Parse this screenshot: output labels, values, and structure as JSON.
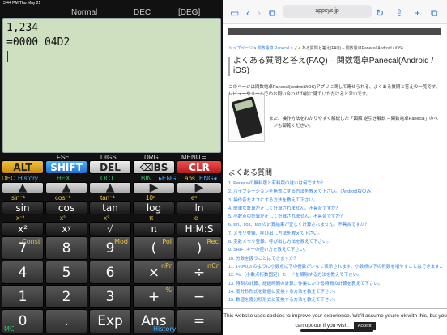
{
  "status": {
    "time": "3:44 PM",
    "date": "Thu May 21"
  },
  "modebar": {
    "mode": "Normal",
    "base": "DEC",
    "angle": "[DEG]"
  },
  "display": {
    "line1": "1,234",
    "line2": "=0000 04D2"
  },
  "colors": {
    "alt": "#f0c23c",
    "shift": "#4cb0ff",
    "clr": "#f26060",
    "hex": "#3cc06c",
    "link": "#2a7ae4"
  },
  "keys": {
    "row1_labels": [
      "FSE",
      "DIGS",
      "DRG",
      "MENU ="
    ],
    "alt": "ALT",
    "shift": "SHIFT",
    "del": "DEL",
    "bs": "⌫BS",
    "clr": "CLR",
    "row2_labels": [
      "DEC",
      "History",
      "HEX",
      "OCT",
      "BIN",
      "▸ENG",
      "abs",
      "ENG◂"
    ],
    "nav": [
      "▲",
      "▲",
      "▲",
      "▶",
      "▶"
    ],
    "sup3": [
      "sin⁻¹",
      "cos⁻¹",
      "tan⁻¹",
      "10ˣ",
      "eˣ"
    ],
    "fn3": [
      "sin",
      "cos",
      "tan",
      "log",
      "ln"
    ],
    "sup4": [
      "x⁻¹",
      "x²",
      "x³",
      "π",
      "e"
    ],
    "fn4": [
      "x²",
      "xʸ",
      "√",
      "π",
      "H:M:S"
    ],
    "row5": [
      "7",
      "8",
      "9",
      "(",
      ")"
    ],
    "row5_sub": [
      "Const",
      "Mod",
      "Pol",
      "Rec"
    ],
    "row6": [
      "4",
      "5",
      "6",
      "×",
      "÷"
    ],
    "row6_sub": [
      "nPr",
      "nCr"
    ],
    "row7": [
      "1",
      "2",
      "3",
      "+",
      "−"
    ],
    "row7_sub": [
      "%"
    ],
    "row8": [
      "0",
      ".",
      "Exp",
      "Ans",
      "="
    ],
    "row8_sub": [
      "MC",
      "History"
    ]
  },
  "browser": {
    "url": "appsys.jp",
    "icons": [
      "sidebar-icon",
      "back-icon",
      "forward-icon",
      "book-icon",
      "reload-icon",
      "share-icon",
      "add-icon",
      "tabs-icon"
    ],
    "breadcrumb": [
      "トップページ",
      "関数電卓 Panecal",
      "よくある質問と答え(FAQ) – 関数電卓Panecal(Android / iOS)"
    ],
    "title": "よくある質問と答え(FAQ) – 関数電卓Panecal(Android / iOS)",
    "intro": [
      "このページは関数電卓Panecal(Android/iOS)アプリに関して寄せられる、よくある質問と答えの一覧です。レビューやメールでのお問い合わせの前に見ていただけると幸いです。",
      "また、操作方法をわかりやすく解説した「図解 逆引き解説 – 関数電卓Panecal」のページも御覧ください。"
    ],
    "heading": "よくある質問",
    "faq": [
      "1. Panecalの無料版と有料版の違いは何ですか？",
      "2. バイブレーションを無効にする方法を教えて下さい。（Android版のみ）",
      "3. 操作音をオフにする方法を教えて下さい。",
      "4. 簡単な計算が正しく計算されません。不具合ですか？",
      "5. 小数点の計算が正しく計算されません。不具合ですか？",
      "6. sin、cos、tan の計算結果が正しく計算されません。不具合ですか？",
      "7. メモリ登録、呼び出し方法を教えて下さい。",
      "8. 変数メモリ登録、呼び出し方法を教えて下さい。",
      "9. SHIFTキーの使い方を教えて下さい。",
      "10. 分数を扱うことはできますか？",
      "11. 1÷3=0.3 のように小数点以下の桁数が少なく表示されます。小数点以下の桁数を増やすことはできますか？",
      "12. Fix（小数点桁数固定）モードを解除する方法を教えて下さい。",
      "13. 時刻の計算、経過時間の計算、作業にかかる時間の計算を教えて下さい。",
      "14. 度分秒形式を数値に変換する方法を教えて下さい。",
      "15. 数値を度分秒形式に変換する方法を教えて下さい。"
    ],
    "cookie": "This website uses cookies to improve your experience. We'll assume you're ok with this, but you can opt-out if you wish.",
    "accept": "Accept"
  }
}
